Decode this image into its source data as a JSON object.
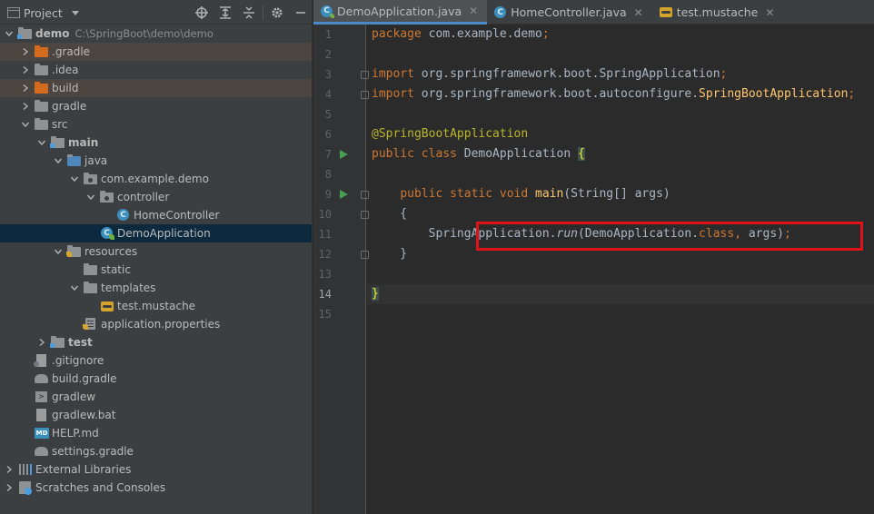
{
  "project_panel": {
    "title": "Project",
    "tree": [
      {
        "label": "demo",
        "path": "C:\\SpringBoot\\demo\\demo",
        "depth": 0,
        "expanded": true,
        "icon": "module-folder-icon",
        "bold": true
      },
      {
        "label": ".gradle",
        "depth": 1,
        "expanded": false,
        "icon": "excluded-folder-icon",
        "excluded": true
      },
      {
        "label": ".idea",
        "depth": 1,
        "expanded": false,
        "icon": "folder-icon"
      },
      {
        "label": "build",
        "depth": 1,
        "expanded": false,
        "icon": "excluded-folder-icon",
        "excluded": true
      },
      {
        "label": "gradle",
        "depth": 1,
        "expanded": false,
        "icon": "folder-icon"
      },
      {
        "label": "src",
        "depth": 1,
        "expanded": true,
        "icon": "folder-icon"
      },
      {
        "label": "main",
        "depth": 2,
        "expanded": true,
        "icon": "source-root-folder-icon",
        "bold": true
      },
      {
        "label": "java",
        "depth": 3,
        "expanded": true,
        "icon": "java-source-folder-icon"
      },
      {
        "label": "com.example.demo",
        "depth": 4,
        "expanded": true,
        "icon": "package-icon"
      },
      {
        "label": "controller",
        "depth": 5,
        "expanded": true,
        "icon": "package-icon"
      },
      {
        "label": "HomeController",
        "depth": 6,
        "icon": "class-icon"
      },
      {
        "label": "DemoApplication",
        "depth": 5,
        "icon": "spring-class-icon",
        "selected": true
      },
      {
        "label": "resources",
        "depth": 3,
        "expanded": true,
        "icon": "resources-folder-icon"
      },
      {
        "label": "static",
        "depth": 4,
        "icon": "folder-icon"
      },
      {
        "label": "templates",
        "depth": 4,
        "expanded": true,
        "icon": "folder-icon"
      },
      {
        "label": "test.mustache",
        "depth": 5,
        "icon": "mustache-file-icon"
      },
      {
        "label": "application.properties",
        "depth": 4,
        "icon": "properties-file-icon"
      },
      {
        "label": "test",
        "depth": 2,
        "expanded": false,
        "icon": "source-root-folder-icon",
        "bold": true
      },
      {
        "label": ".gitignore",
        "depth": 1,
        "icon": "gitignore-file-icon"
      },
      {
        "label": "build.gradle",
        "depth": 1,
        "icon": "gradle-file-icon"
      },
      {
        "label": "gradlew",
        "depth": 1,
        "icon": "shell-file-icon"
      },
      {
        "label": "gradlew.bat",
        "depth": 1,
        "icon": "file-icon"
      },
      {
        "label": "HELP.md",
        "depth": 1,
        "icon": "markdown-file-icon"
      },
      {
        "label": "settings.gradle",
        "depth": 1,
        "icon": "gradle-file-icon"
      },
      {
        "label": "External Libraries",
        "depth": 0,
        "expanded": false,
        "icon": "libraries-icon"
      },
      {
        "label": "Scratches and Consoles",
        "depth": 0,
        "expanded": false,
        "icon": "scratches-icon"
      }
    ]
  },
  "editor": {
    "tabs": [
      {
        "label": "DemoApplication.java",
        "active": true,
        "icon": "spring-class-icon"
      },
      {
        "label": "HomeController.java",
        "active": false,
        "icon": "class-icon"
      },
      {
        "label": "test.mustache",
        "active": false,
        "icon": "mustache-file-icon"
      }
    ],
    "current_line": 14,
    "lines": [
      {
        "n": "1",
        "html": "<span class=\"kw\">package</span> com.example.demo<span class=\"kw\">;</span>"
      },
      {
        "n": "2",
        "html": ""
      },
      {
        "n": "3",
        "html": "<span class=\"kw\">import</span> org.springframework.boot.SpringApplication<span class=\"kw\">;</span>"
      },
      {
        "n": "4",
        "html": "<span class=\"kw\">import</span> org.springframework.boot.autoconfigure.<span class=\"mod\">SpringBootApplication</span><span class=\"kw\">;</span>"
      },
      {
        "n": "5",
        "html": ""
      },
      {
        "n": "6",
        "html": "<span class=\"ann\">@SpringBootApplication</span>"
      },
      {
        "n": "7",
        "html": "<span class=\"kw\">public class</span> DemoApplication <span class=\"brace\">{</span>"
      },
      {
        "n": "8",
        "html": ""
      },
      {
        "n": "9",
        "html": "    <span class=\"kw\">public static void</span> <span class=\"mod\">main</span>(String[] args)"
      },
      {
        "n": "10",
        "html": "    {"
      },
      {
        "n": "11",
        "html": "        SpringApplication.<span class=\"it\">run</span>(DemoApplication.<span class=\"kw\">class</span><span class=\"kw\">,</span> args)<span class=\"kw\">;</span>"
      },
      {
        "n": "12",
        "html": "    }"
      },
      {
        "n": "13",
        "html": ""
      },
      {
        "n": "14",
        "html": "<span class=\"brace\">}</span>"
      },
      {
        "n": "15",
        "html": ""
      }
    ],
    "run_gutter_lines": [
      7,
      9
    ],
    "fold_lines": [
      3,
      4,
      9,
      10,
      12
    ]
  },
  "colors": {
    "highlight_box": "#e0131b",
    "selection": "#0d293e",
    "excluded": "#4d4540",
    "accent": "#4a88c7"
  }
}
